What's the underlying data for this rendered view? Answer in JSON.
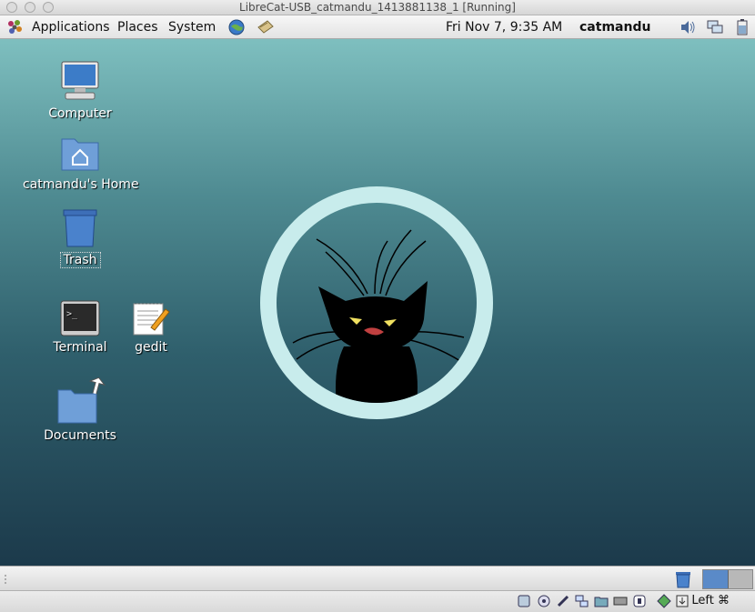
{
  "window": {
    "title": "LibreCat-USB_catmandu_1413881138_1 [Running]"
  },
  "top_panel": {
    "menus": [
      "Applications",
      "Places",
      "System"
    ],
    "datetime": "Fri Nov  7,  9:35 AM",
    "username": "catmandu",
    "launchers": [
      "browser-globe-icon",
      "mail-icon"
    ],
    "tray": [
      "volume-icon",
      "network-icon",
      "battery-icon"
    ]
  },
  "desktop": {
    "icons": [
      {
        "label": "Computer",
        "icon": "computer-icon"
      },
      {
        "label": "catmandu's Home",
        "icon": "home-folder-icon"
      },
      {
        "label": "Trash",
        "icon": "trash-icon"
      },
      {
        "label": "Terminal",
        "icon": "terminal-icon"
      },
      {
        "label": "gedit",
        "icon": "gedit-icon"
      },
      {
        "label": "Documents",
        "icon": "documents-folder-icon"
      }
    ],
    "wallpaper": {
      "logo": "black-cat-in-ring",
      "ring_color": "#c8ecec"
    }
  },
  "bottom_panel": {
    "workspaces": 2,
    "active_workspace": 1
  },
  "vbox_status": {
    "icons": [
      "hard-disk-icon",
      "optical-drive-icon",
      "usb-icon",
      "network-adapter-icon",
      "shared-folders-icon",
      "display-icon",
      "video-capture-icon",
      "cpu-icon",
      "mouse-integration-icon",
      "keyboard-capture-icon"
    ],
    "host_key": "Left ⌘"
  },
  "colors": {
    "desktop_top": "#7ebfbf",
    "desktop_bottom": "#1c3a4b"
  }
}
